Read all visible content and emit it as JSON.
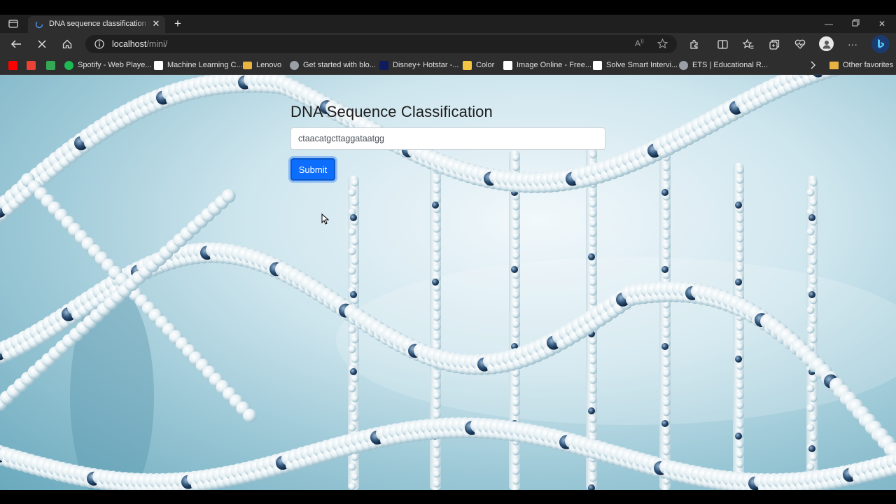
{
  "tab": {
    "title": "DNA sequence classification usin"
  },
  "toolbar": {
    "url_host": "localhost",
    "url_path": "/mini/"
  },
  "bookmarks": [
    {
      "label": "",
      "icon": "youtube-icon",
      "color": "#ff0000"
    },
    {
      "label": "",
      "icon": "gmail-icon",
      "color": "#ea4335"
    },
    {
      "label": "",
      "icon": "google-drive-icon",
      "color": "#34a853"
    },
    {
      "label": "Spotify - Web Playe...",
      "icon": "spotify-icon",
      "color": "#1db954"
    },
    {
      "label": "Machine Learning C...",
      "icon": "ml-icon",
      "color": "#ffffff"
    },
    {
      "label": "Lenovo",
      "icon": "folder-icon",
      "color": "#e8b341"
    },
    {
      "label": "Get started with blo...",
      "icon": "blog-icon",
      "color": "#9aa0a6"
    },
    {
      "label": "Disney+ Hotstar -...",
      "icon": "hotstar-icon",
      "color": "#0f1b5c"
    },
    {
      "label": "Color",
      "icon": "color-icon",
      "color": "#f4c542"
    },
    {
      "label": "Image Online - Free...",
      "icon": "io-icon",
      "color": "#ffffff"
    },
    {
      "label": "Solve Smart Intervi...",
      "icon": "he-icon",
      "color": "#ffffff"
    },
    {
      "label": "ETS | Educational R...",
      "icon": "ets-icon",
      "color": "#9aa0a6"
    }
  ],
  "other_favorites": "Other favorites",
  "main": {
    "heading": "DNA Sequence Classification",
    "input_value": "ctaacatgcttaggataatgg",
    "submit_label": "Submit"
  },
  "colors": {
    "accent": "#0d6efd",
    "chrome_bg": "#2e2e2e"
  }
}
